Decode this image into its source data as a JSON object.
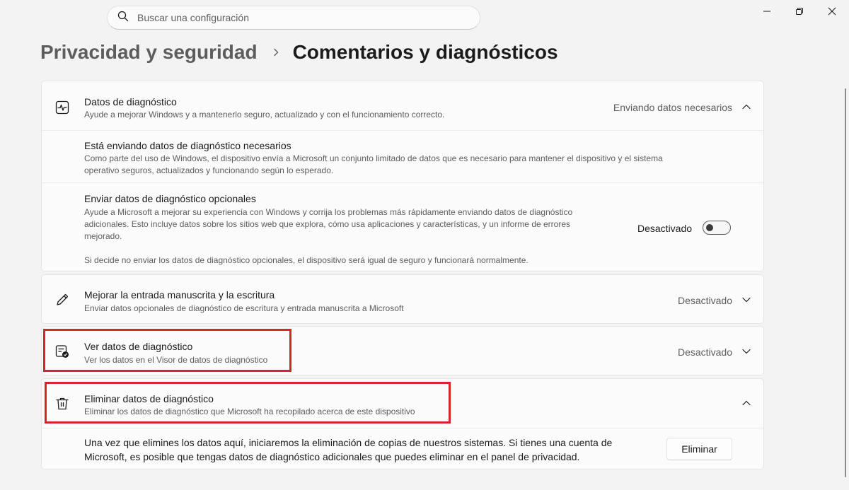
{
  "search": {
    "placeholder": "Buscar una configuración"
  },
  "breadcrumb": {
    "parent": "Privacidad y seguridad",
    "current": "Comentarios y diagnósticos"
  },
  "diagnostic_data": {
    "title": "Datos de diagnóstico",
    "description": "Ayude a mejorar Windows y a mantenerlo seguro, actualizado y con el funcionamiento correcto.",
    "value": "Enviando datos necesarios",
    "required": {
      "title": "Está enviando datos de diagnóstico necesarios",
      "description_line1": "Como parte del uso de Windows, el dispositivo envía a Microsoft un conjunto limitado de datos que es necesario para mantener el dispositivo y el sistema",
      "description_line2": "operativo seguros, actualizados y funcionando según lo esperado."
    },
    "optional": {
      "title": "Enviar datos de diagnóstico opcionales",
      "description_line1": "Ayude a Microsoft a mejorar su experiencia con Windows y corrija los problemas más rápidamente enviando datos de diagnóstico",
      "description_line2": "adicionales. Esto incluye datos sobre los sitios web que explora, cómo usa aplicaciones y características, y un informe de errores",
      "description_line3": "mejorado.",
      "note": "Si decide no enviar los datos de diagnóstico opcionales, el dispositivo será igual de seguro y funcionará normalmente.",
      "toggle_label": "Desactivado",
      "toggle_on": false
    }
  },
  "inking": {
    "title": "Mejorar la entrada manuscrita y la escritura",
    "description": "Enviar datos opcionales de diagnóstico de escritura y entrada manuscrita a Microsoft",
    "value": "Desactivado"
  },
  "view_data": {
    "title": "Ver datos de diagnóstico",
    "description": "Ver los datos en el Visor de datos de diagnóstico",
    "value": "Desactivado"
  },
  "delete_data": {
    "title": "Eliminar datos de diagnóstico",
    "description": "Eliminar los datos de diagnóstico que Microsoft ha recopilado acerca de este dispositivo",
    "body_line1": "Una vez que elimines los datos aquí, iniciaremos la eliminación de copias de nuestros sistemas. Si tienes una cuenta de",
    "body_line2": "Microsoft, es posible que tengas datos de diagnóstico adicionales que puedes eliminar en el panel de privacidad.",
    "button_label": "Eliminar"
  },
  "colors": {
    "highlight": "#d1272b",
    "background": "#f3f3f3",
    "card": "#fbfbfb"
  }
}
